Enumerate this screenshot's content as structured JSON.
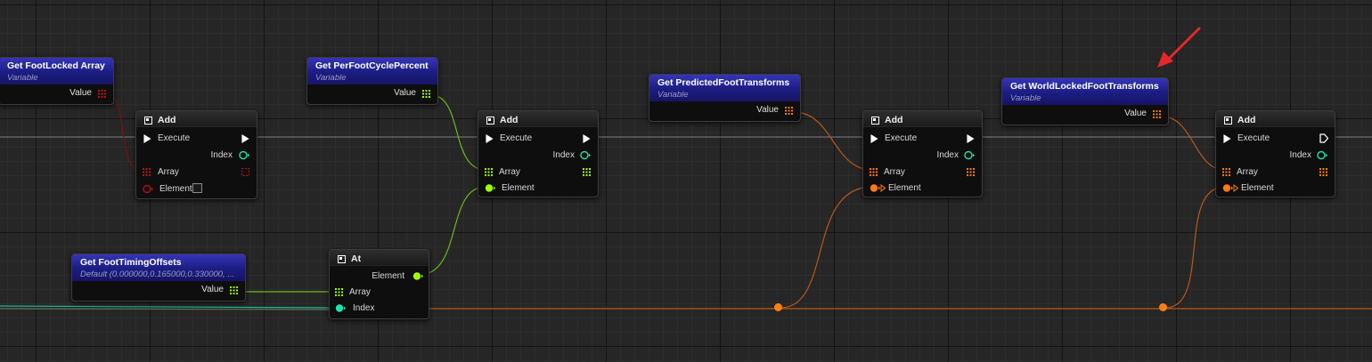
{
  "colors": {
    "background": "#262626",
    "exec_pin": "#ffffff",
    "int_pin": "#1fe3af",
    "float_pin": "#9cff00",
    "float_wire": "#7fd51e",
    "bool_pin": "#8c0000",
    "transform_pin": "#ff7a12",
    "transform_wire": "#d9671a",
    "variable_header": "#1c1c82",
    "annotation_arrow": "#e8262a"
  },
  "nodes": {
    "foot_locked_array": {
      "title": "Get FootLocked Array",
      "subtitle": "Variable",
      "output": "Value",
      "pin_icon": "bool-array-pin-icon"
    },
    "per_foot_cycle": {
      "title": "Get PerFootCyclePercent",
      "subtitle": "Variable",
      "output": "Value",
      "pin_icon": "float-array-pin-icon"
    },
    "predicted_transforms": {
      "title": "Get PredictedFootTransforms",
      "subtitle": "Variable",
      "output": "Value",
      "pin_icon": "transform-array-pin-icon"
    },
    "world_locked_transforms": {
      "title": "Get WorldLockedFootTransforms",
      "subtitle": "Variable",
      "output": "Value",
      "pin_icon": "transform-array-pin-icon"
    },
    "foot_timing_offsets": {
      "title": "Get FootTimingOffsets",
      "subtitle": "Default (0.000000,0.165000,0.330000, ...",
      "output": "Value",
      "pin_icon": "float-array-pin-icon"
    },
    "add_1": {
      "title": "Add",
      "execute": "Execute",
      "index": "Index",
      "array": "Array",
      "element": "Element"
    },
    "add_2": {
      "title": "Add",
      "execute": "Execute",
      "index": "Index",
      "array": "Array",
      "element": "Element"
    },
    "add_3": {
      "title": "Add",
      "execute": "Execute",
      "index": "Index",
      "array": "Array",
      "element": "Element"
    },
    "add_4": {
      "title": "Add",
      "execute": "Execute",
      "index": "Index",
      "array": "Array",
      "element": "Element"
    },
    "at": {
      "title": "At",
      "element": "Element",
      "array": "Array",
      "index": "Index"
    }
  }
}
